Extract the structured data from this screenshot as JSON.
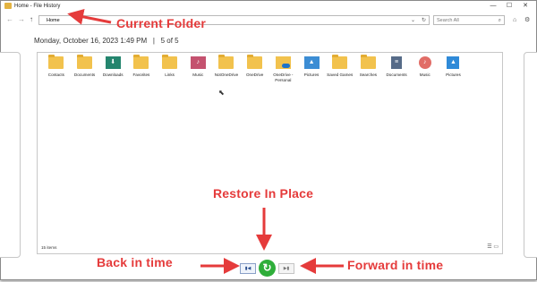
{
  "window": {
    "title": "Home - File History",
    "minimize": "—",
    "maximize": "☐",
    "close": "✕"
  },
  "toolbar": {
    "back": "←",
    "forward": "→",
    "up": "↑",
    "address": "Home",
    "search_placeholder": "Search All",
    "home_icon": "⌂",
    "settings_icon": "⚙"
  },
  "header": {
    "date": "Monday, October 16, 2023 1:49 PM",
    "separator": "|",
    "position": "5 of 5"
  },
  "items": [
    {
      "label": "Contacts",
      "icon": "folder-icon"
    },
    {
      "label": "Documents",
      "icon": "folder-icon"
    },
    {
      "label": "Downloads",
      "icon": "downloads-icon"
    },
    {
      "label": "Favorites",
      "icon": "folder-icon"
    },
    {
      "label": "Links",
      "icon": "folder-icon"
    },
    {
      "label": "Music",
      "icon": "music-folder-icon"
    },
    {
      "label": "NotOneDrive",
      "icon": "folder-icon"
    },
    {
      "label": "OneDrive",
      "icon": "folder-icon"
    },
    {
      "label": "OneDrive - Personal",
      "icon": "onedrive-folder-icon"
    },
    {
      "label": "Pictures",
      "icon": "pictures-folder-icon"
    },
    {
      "label": "Saved Games",
      "icon": "folder-icon"
    },
    {
      "label": "Searches",
      "icon": "folder-icon"
    },
    {
      "label": "Documents",
      "icon": "documents-library-icon"
    },
    {
      "label": "Music",
      "icon": "music-library-icon"
    },
    {
      "label": "Pictures",
      "icon": "pictures-library-icon"
    }
  ],
  "status": {
    "count": "15 items"
  },
  "annotations": {
    "current_folder": "Current Folder",
    "restore_in_place": "Restore In Place",
    "back_in_time": "Back in time",
    "forward_in_time": "Forward in time"
  },
  "colors": {
    "annotation": "#e53b3b",
    "restore_button": "#2fae3a",
    "folder": "#f2c24d"
  }
}
